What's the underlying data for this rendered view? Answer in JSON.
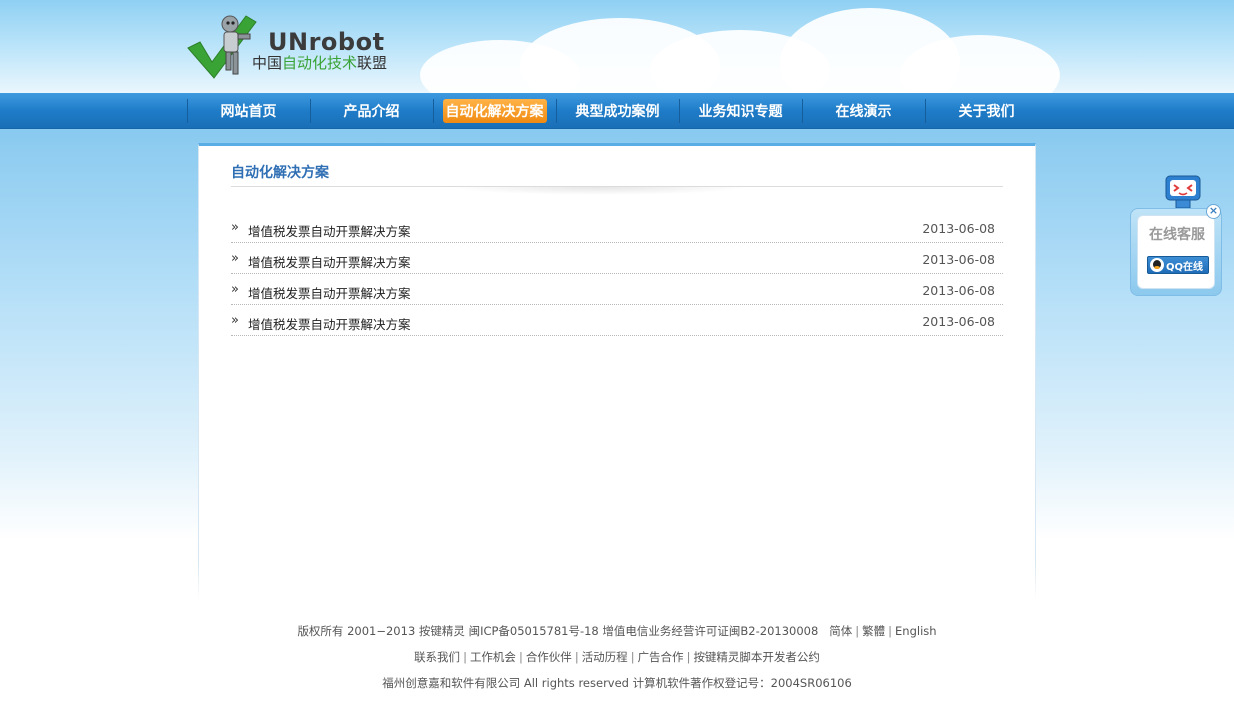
{
  "brand": {
    "name": "UNrobot",
    "tagline_prefix": "中国",
    "tagline_highlight": "自动化技术",
    "tagline_suffix": "联盟"
  },
  "nav": {
    "items": [
      {
        "label": "网站首页",
        "active": false
      },
      {
        "label": "产品介绍",
        "active": false
      },
      {
        "label": "自动化解决方案",
        "active": true
      },
      {
        "label": "典型成功案例",
        "active": false
      },
      {
        "label": "业务知识专题",
        "active": false
      },
      {
        "label": "在线演示",
        "active": false
      },
      {
        "label": "关于我们",
        "active": false
      }
    ]
  },
  "main": {
    "section_title": "自动化解决方案",
    "articles": [
      {
        "title": "增值税发票自动开票解决方案",
        "date": "2013-06-08"
      },
      {
        "title": "增值税发票自动开票解决方案",
        "date": "2013-06-08"
      },
      {
        "title": "增值税发票自动开票解决方案",
        "date": "2013-06-08"
      },
      {
        "title": "增值税发票自动开票解决方案",
        "date": "2013-06-08"
      }
    ]
  },
  "footer": {
    "copyright": "版权所有 2001−2013 按键精灵  闽ICP备05015781号-18   增值电信业务经营许可证闽B2-20130008",
    "lang_simplified": "简体",
    "lang_traditional": "繁體",
    "lang_english": "English",
    "links": [
      "联系我们",
      "工作机会",
      "合作伙伴",
      "活动历程",
      "广告合作",
      "按键精灵脚本开发者公约"
    ],
    "company_line": "福州创意嘉和软件有限公司 All rights reserved 计算机软件著作权登记号：2004SR06106"
  },
  "service_widget": {
    "title": "在线客服",
    "qq_label": "QQ在线",
    "close_symbol": "×"
  },
  "colors": {
    "nav_blue": "#1f7cc8",
    "active_orange": "#f08a12",
    "title_blue": "#2f6fb4",
    "logo_green": "#3aa336"
  },
  "icons": [
    "robot-logo-icon",
    "double-chevron-icon",
    "qq-penguin-icon",
    "close-icon",
    "robot-mascot-icon"
  ]
}
